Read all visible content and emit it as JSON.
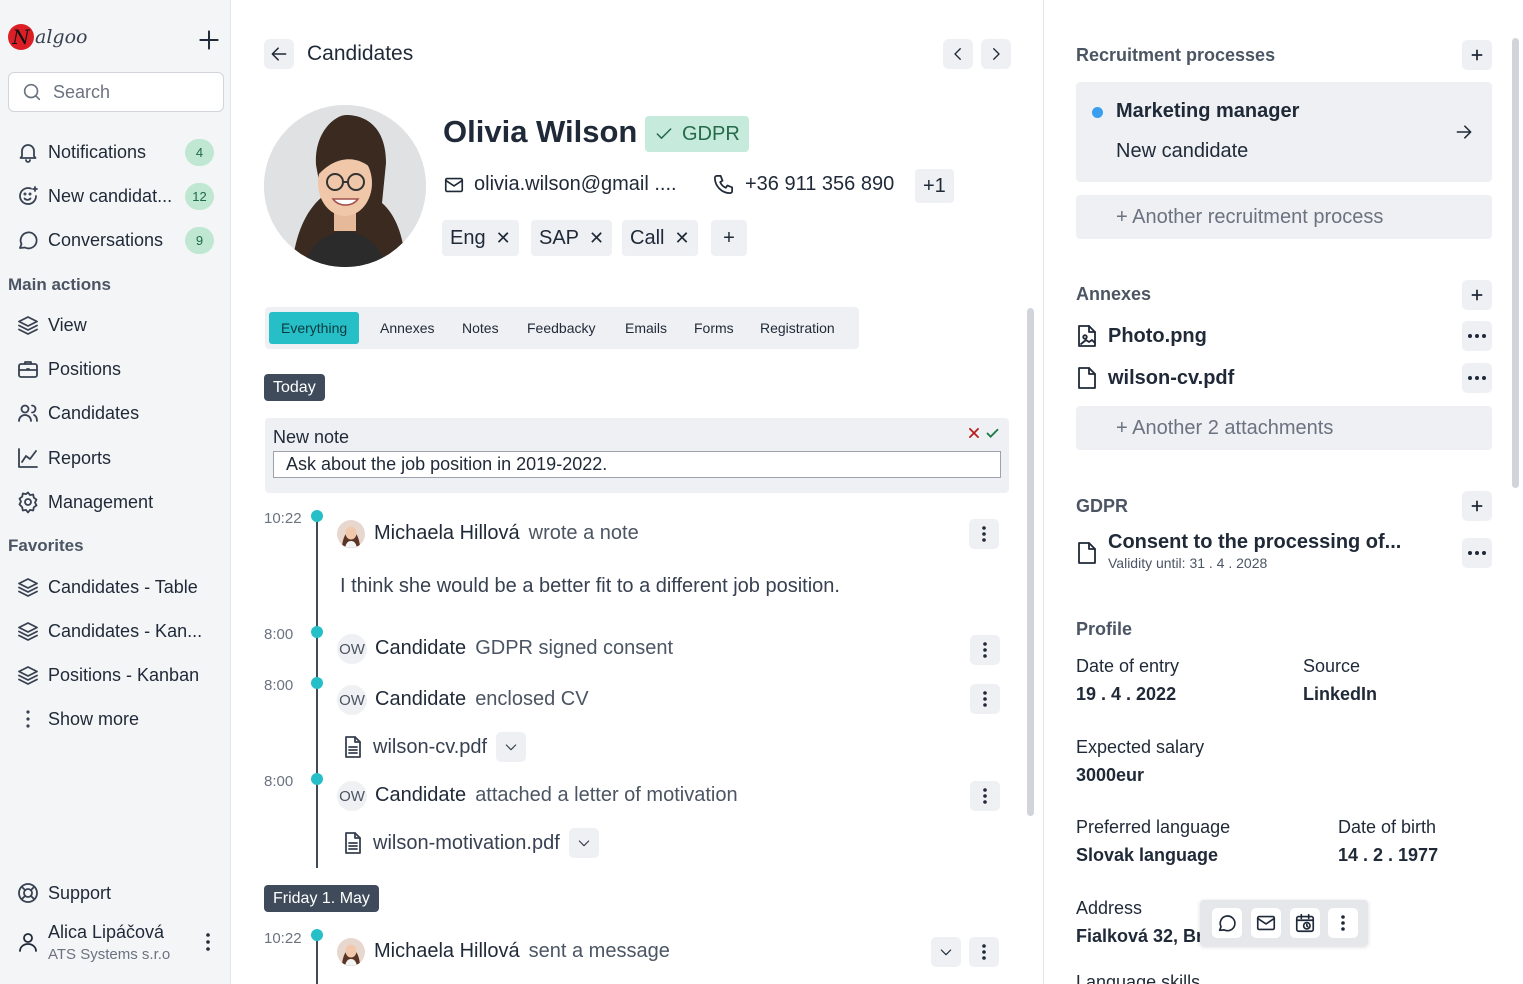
{
  "app": {
    "logo_initial": "N",
    "logo_text": "algoo"
  },
  "sidebar": {
    "search_placeholder": "Search",
    "top_items": [
      {
        "label": "Notifications",
        "badge": "4",
        "icon": "bell-icon"
      },
      {
        "label": "New candidat...",
        "badge": "12",
        "icon": "new-candidate-icon"
      },
      {
        "label": "Conversations",
        "badge": "9",
        "icon": "chat-icon"
      }
    ],
    "main_actions_title": "Main actions",
    "main_actions": [
      {
        "label": "View",
        "icon": "layers-icon"
      },
      {
        "label": "Positions",
        "icon": "briefcase-icon"
      },
      {
        "label": "Candidates",
        "icon": "users-icon"
      },
      {
        "label": "Reports",
        "icon": "chart-icon"
      },
      {
        "label": "Management",
        "icon": "gear-icon"
      }
    ],
    "favorites_title": "Favorites",
    "favorites": [
      {
        "label": "Candidates - Table",
        "icon": "layers-icon"
      },
      {
        "label": "Candidates - Kan...",
        "icon": "layers-icon"
      },
      {
        "label": "Positions - Kanban",
        "icon": "layers-icon"
      }
    ],
    "show_more": "Show more",
    "support": "Support",
    "user": {
      "name": "Alica Lipáčová",
      "company": "ATS Systems s.r.o"
    }
  },
  "header": {
    "title": "Candidates"
  },
  "candidate": {
    "name": "Olivia Wilson",
    "gdpr_badge": "GDPR",
    "email": "olivia.wilson@gmail ....",
    "phone": "+36 911 356 890",
    "phone_more": "+1",
    "tags": [
      "Eng",
      "SAP",
      "Call"
    ],
    "add_tag": "+"
  },
  "tabs": [
    "Everything",
    "Annexes",
    "Notes",
    "Feedbacky",
    "Emails",
    "Forms",
    "Registration"
  ],
  "timeline": {
    "today_label": "Today",
    "new_note": {
      "title": "New note",
      "value": "Ask about the job position in 2019-2022."
    },
    "events": [
      {
        "time": "10:22",
        "who": "Michaela Hillová",
        "action": "wrote a note",
        "body": "I think she would be a better fit to a different job position."
      },
      {
        "time": "8:00",
        "initials": "OW",
        "who": "Candidate",
        "action": "GDPR signed consent"
      },
      {
        "time": "8:00",
        "initials": "OW",
        "who": "Candidate",
        "action": "enclosed CV",
        "file": "wilson-cv.pdf"
      },
      {
        "time": "8:00",
        "initials": "OW",
        "who": "Candidate",
        "action": "attached a letter of motivation",
        "file": "wilson-motivation.pdf"
      }
    ],
    "day2_label": "Friday 1. May",
    "events2": [
      {
        "time": "10:22",
        "who": "Michaela Hillová",
        "action": "sent a message"
      }
    ]
  },
  "right": {
    "recruitment_title": "Recruitment processes",
    "process": {
      "title": "Marketing manager",
      "status": "New candidate",
      "status_color": "#3b9ff0"
    },
    "another_process": "+ Another recruitment process",
    "annexes_title": "Annexes",
    "annexes": [
      "Photo.png",
      "wilson-cv.pdf"
    ],
    "another_attachments": "+ Another 2 attachments",
    "gdpr_title": "GDPR",
    "gdpr_doc": {
      "title": "Consent to the processing of...",
      "validity": "Validity until: 31 . 4 . 2028"
    },
    "profile_title": "Profile",
    "profile": {
      "date_of_entry_label": "Date of entry",
      "date_of_entry": "19 . 4 . 2022",
      "source_label": "Source",
      "source": "LinkedIn",
      "salary_label": "Expected salary",
      "salary": "3000eur",
      "language_label": "Preferred language",
      "language": "Slovak language",
      "dob_label": "Date of birth",
      "dob": "14 . 2 . 1977",
      "address_label": "Address",
      "address": "Fialková 32, Br",
      "next_label": "Language skills"
    }
  },
  "colors": {
    "accent": "#26bfc7",
    "badge_bg": "#bfe7d1",
    "gdpr_bg": "#c6eadb",
    "dark_tag": "#3f4b5b"
  }
}
